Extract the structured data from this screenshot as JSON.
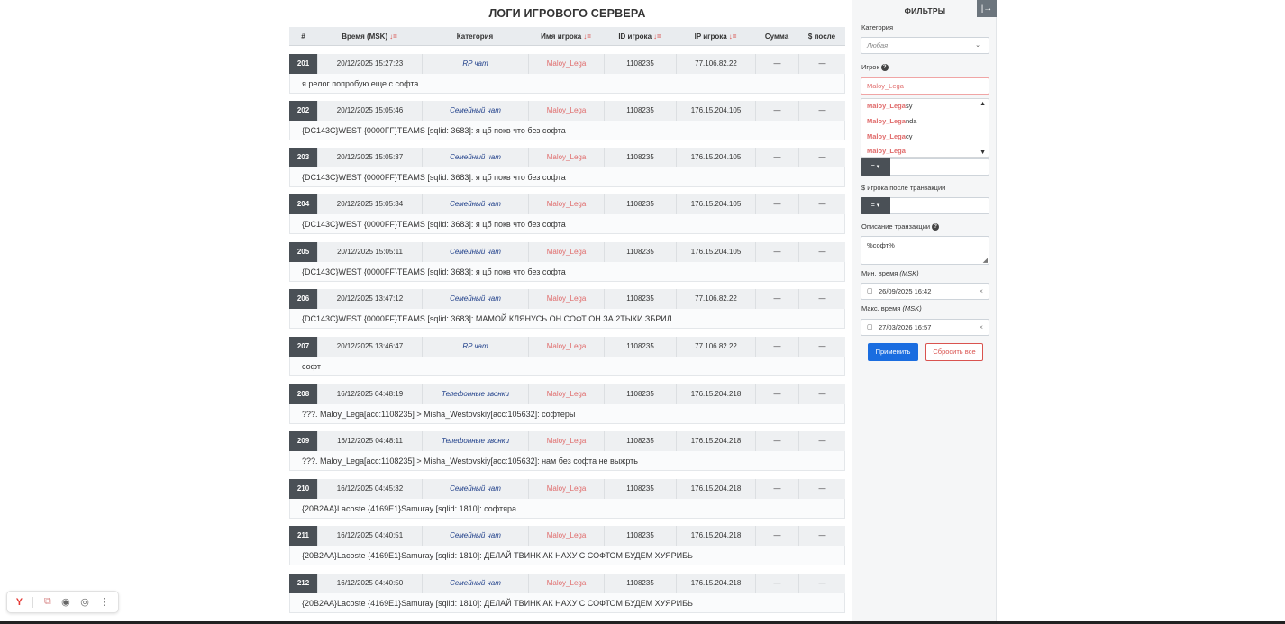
{
  "title": "ЛОГИ ИГРОВОГО СЕРВЕРА",
  "columns": {
    "num": "#",
    "time": "Время (MSK)",
    "category": "Категория",
    "player": "Имя игрока",
    "player_id": "ID игрока",
    "ip": "IP игрока",
    "sum": "Сумма",
    "after": "$ после",
    "sort_icon": "↓="
  },
  "rows": [
    {
      "num": "201",
      "time": "20/12/2025 15:27:23",
      "category": "RP чат",
      "player": "Maloy_Lega",
      "id": "1108235",
      "ip": "77.106.82.22",
      "sum": "—",
      "after": "—",
      "message": "я релог попробую еще с софта"
    },
    {
      "num": "202",
      "time": "20/12/2025 15:05:46",
      "category": "Семейный чат",
      "player": "Maloy_Lega",
      "id": "1108235",
      "ip": "176.15.204.105",
      "sum": "—",
      "after": "—",
      "message": "{DC143C}WEST {0000FF}TEAMS [sqlid: 3683]: я цб покв что без софта"
    },
    {
      "num": "203",
      "time": "20/12/2025 15:05:37",
      "category": "Семейный чат",
      "player": "Maloy_Lega",
      "id": "1108235",
      "ip": "176.15.204.105",
      "sum": "—",
      "after": "—",
      "message": "{DC143C}WEST {0000FF}TEAMS [sqlid: 3683]: я цб покв что без софта"
    },
    {
      "num": "204",
      "time": "20/12/2025 15:05:34",
      "category": "Семейный чат",
      "player": "Maloy_Lega",
      "id": "1108235",
      "ip": "176.15.204.105",
      "sum": "—",
      "after": "—",
      "message": "{DC143C}WEST {0000FF}TEAMS [sqlid: 3683]: я цб покв что без софта"
    },
    {
      "num": "205",
      "time": "20/12/2025 15:05:11",
      "category": "Семейный чат",
      "player": "Maloy_Lega",
      "id": "1108235",
      "ip": "176.15.204.105",
      "sum": "—",
      "after": "—",
      "message": "{DC143C}WEST {0000FF}TEAMS [sqlid: 3683]: я цб покв что без софта"
    },
    {
      "num": "206",
      "time": "20/12/2025 13:47:12",
      "category": "Семейный чат",
      "player": "Maloy_Lega",
      "id": "1108235",
      "ip": "77.106.82.22",
      "sum": "—",
      "after": "—",
      "message": "{DC143C}WEST {0000FF}TEAMS [sqlid: 3683]: МАМОЙ КЛЯНУСЬ ОН СОФТ ОН ЗА 2ТЫКИ ЗБРИЛ"
    },
    {
      "num": "207",
      "time": "20/12/2025 13:46:47",
      "category": "RP чат",
      "player": "Maloy_Lega",
      "id": "1108235",
      "ip": "77.106.82.22",
      "sum": "—",
      "after": "—",
      "message": "софт"
    },
    {
      "num": "208",
      "time": "16/12/2025 04:48:19",
      "category": "Телефонные звонки",
      "player": "Maloy_Lega",
      "id": "1108235",
      "ip": "176.15.204.218",
      "sum": "—",
      "after": "—",
      "message": "???. Maloy_Lega[acc:1108235] > Misha_Westovskiy[acc:105632]: софтеры"
    },
    {
      "num": "209",
      "time": "16/12/2025 04:48:11",
      "category": "Телефонные звонки",
      "player": "Maloy_Lega",
      "id": "1108235",
      "ip": "176.15.204.218",
      "sum": "—",
      "after": "—",
      "message": "???. Maloy_Lega[acc:1108235] > Misha_Westovskiy[acc:105632]: нам без софта не выжрть"
    },
    {
      "num": "210",
      "time": "16/12/2025 04:45:32",
      "category": "Семейный чат",
      "player": "Maloy_Lega",
      "id": "1108235",
      "ip": "176.15.204.218",
      "sum": "—",
      "after": "—",
      "message": "{20B2AA}Lacoste {4169E1}Samuray [sqlid: 1810]: софтяра"
    },
    {
      "num": "211",
      "time": "16/12/2025 04:40:51",
      "category": "Семейный чат",
      "player": "Maloy_Lega",
      "id": "1108235",
      "ip": "176.15.204.218",
      "sum": "—",
      "after": "—",
      "message": "{20B2AA}Lacoste {4169E1}Samuray [sqlid: 1810]: ДЕЛАЙ ТВИНК АК НАХУ С СОФТОМ БУДЕМ ХУЯРИБЬ"
    },
    {
      "num": "212",
      "time": "16/12/2025 04:40:50",
      "category": "Семейный чат",
      "player": "Maloy_Lega",
      "id": "1108235",
      "ip": "176.15.204.218",
      "sum": "—",
      "after": "—",
      "message": "{20B2AA}Lacoste {4169E1}Samuray [sqlid: 1810]: ДЕЛАЙ ТВИНК АК НАХУ С СОФТОМ БУДЕМ ХУЯРИБЬ"
    }
  ],
  "filters": {
    "title": "ФИЛЬТРЫ",
    "collapse_icon": "|→",
    "category_label": "Категория",
    "category_value": "Любая",
    "player_label": "Игрок",
    "player_value": "Maloy_Lega",
    "suggestions": [
      {
        "match": "Maloy_Lega",
        "rest": "sy"
      },
      {
        "match": "Maloy_Lega",
        "rest": "nda"
      },
      {
        "match": "Maloy_Lega",
        "rest": "cy"
      },
      {
        "match": "Maloy_Lega",
        "rest": ""
      }
    ],
    "operator_1": "= ▾",
    "balance_after_label": "$ игрока после транзакции",
    "operator_2": "= ▾",
    "description_label": "Описание транзакции",
    "description_value": "%софт%",
    "min_time_label": "Мин. время",
    "min_time_unit": "(MSK)",
    "min_time_value": "26/09/2025 16:42",
    "max_time_label": "Макс. время",
    "max_time_unit": "(MSK)",
    "max_time_value": "27/03/2026 16:57",
    "apply_label": "Применить",
    "reset_label": "Сбросить все",
    "help_glyph": "?"
  },
  "colors": {
    "accent": "#1a6de0",
    "player_name": "#e06b6b",
    "category": "#1f3f8a",
    "reset": "#d9534f",
    "row_number_bg": "#4a5056"
  }
}
